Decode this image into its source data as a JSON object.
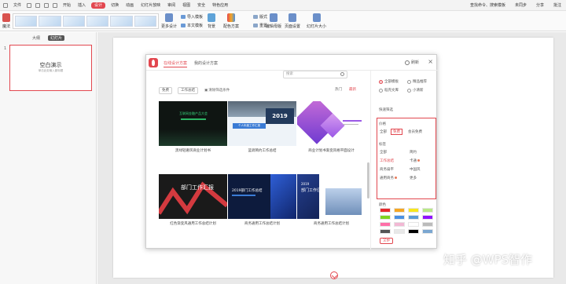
{
  "menubar": {
    "file_label": "文件",
    "items": [
      {
        "label": "开始"
      },
      {
        "label": "插入"
      },
      {
        "label": "设计"
      },
      {
        "label": "切换"
      },
      {
        "label": "动画"
      },
      {
        "label": "幻灯片放映"
      },
      {
        "label": "审阅"
      },
      {
        "label": "视图"
      },
      {
        "label": "安全"
      },
      {
        "label": "特色应用"
      }
    ],
    "active_index": 2,
    "sync_label": "未同步",
    "share_label": "分享",
    "comment_label": "批注",
    "search_label": "查找命令、搜索模板"
  },
  "ribbon": {
    "left_label": "魔法",
    "more_design_label": "更多设计",
    "import_template_label": "导入模板",
    "body_font_label": "本文模板",
    "background_label": "背景",
    "color_scheme_label": "配色方案",
    "format_label": "版式",
    "reset_label": "重置",
    "edit_master_label": "编辑母版",
    "page_setup_label": "页面设置",
    "slide_size_label": "幻灯片大小"
  },
  "left_panel": {
    "tabs": [
      "大纲",
      "幻灯片"
    ],
    "active_tab": 1,
    "slide_number": "1",
    "slide_title": "空白演示",
    "slide_subtitle": "单击此处输入副标题"
  },
  "dialog": {
    "tabs": [
      "在线设计方案",
      "我的设计方案"
    ],
    "active_tab": 0,
    "refresh_label": "刷新",
    "close_label": "×",
    "search_placeholder": "搜索",
    "filter_chips": [
      "免费",
      "工作总结"
    ],
    "clear_filter_label": "清除筛选条件",
    "sort_links": [
      {
        "label": "热门"
      },
      {
        "label": "最新"
      }
    ],
    "sort_active": 1,
    "templates": [
      {
        "title": "黑绿轻奢风商业计划书"
      },
      {
        "title": "蓝调简约工作总结"
      },
      {
        "title": "商业计划书渐变风格平面设计"
      },
      {
        "title": "红色渐变风通用工作总结计划"
      },
      {
        "title": "商务通用工作总结计划"
      },
      {
        "title": "商务通用工作总结计划"
      }
    ],
    "template_texts": {
      "t1": "互联网金融产品大会",
      "t2_year": "2019",
      "t2_label": "个人年度工作汇报",
      "t4_label": "部门工作汇报",
      "t5_label": "2019部门工作总结",
      "t6_year": "2019",
      "t6_label": "部门工作汇报"
    }
  },
  "filter_panel": {
    "radio_options": [
      {
        "label": "全部模板",
        "on": true
      },
      {
        "label": "精品推荐",
        "on": false
      },
      {
        "label": "稻壳文库",
        "on": false
      },
      {
        "label": "小清新",
        "on": false
      }
    ],
    "quick_filter_title": "快速筛选",
    "price_title": "价格",
    "price_options": [
      "全部",
      "免费",
      "会员免费"
    ],
    "price_selected": 1,
    "tag_title": "标签",
    "tag_options": [
      {
        "label": "全部",
        "dot": false
      },
      {
        "label": "简约",
        "dot": false
      },
      {
        "label": "工作总结",
        "dot": false
      },
      {
        "label": "卡通",
        "dot": true
      },
      {
        "label": "商务扁平",
        "dot": false
      },
      {
        "label": "中国风",
        "dot": false
      },
      {
        "label": "通用商务",
        "dot": true
      },
      {
        "label": "更多",
        "dot": false
      }
    ],
    "color_title": "颜色",
    "swatch_colors": [
      "#e6292c",
      "#f5a623",
      "#f8e71c",
      "#b8e986",
      "#7ed321",
      "#4a90e2",
      "#5b9bd5",
      "#9013fe",
      "#ff6fa8",
      "#f2b8d4",
      "#ffffff",
      "#bbbbbb",
      "#555555",
      "#e8e8e8",
      "#000000",
      "#7ba7d1"
    ],
    "all_button_label": "全部"
  },
  "watermark": "知乎 @WPS智作",
  "colors": {
    "accent": "#e2474f",
    "dark_red": "#d33a3f"
  }
}
